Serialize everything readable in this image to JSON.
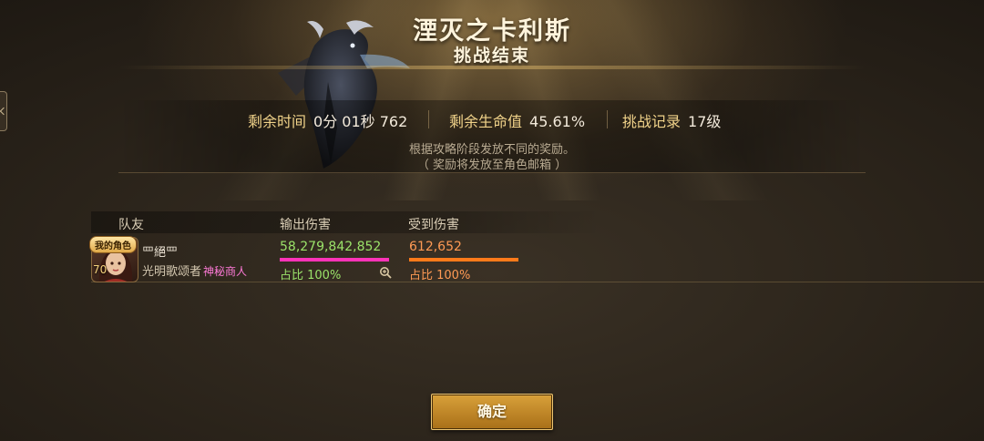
{
  "header": {
    "boss_name": "湮灭之卡利斯",
    "result_title": "挑战结束"
  },
  "stats": {
    "time_label": "剩余时间",
    "time_value": "0分 01秒 762",
    "hp_label": "剩余生命值",
    "hp_value": "45.61%",
    "record_label": "挑战记录",
    "record_value": "17级"
  },
  "notes": {
    "line1": "根据攻略阶段发放不同的奖励。",
    "line2": "（ 奖励将发放至角色邮箱 ）"
  },
  "table": {
    "col_teammate": "队友",
    "col_damage_dealt": "输出伤害",
    "col_damage_taken": "受到伤害"
  },
  "player": {
    "badge": "我的角色",
    "level": "70",
    "name": "罒絕罒",
    "class_name": "光明歌颂者",
    "guild": "神秘商人",
    "damage_dealt": "58,279,842,852",
    "dealt_share_label": "占比 100%",
    "dealt_share": 1.0,
    "damage_taken": "612,652",
    "taken_share_label": "占比 100%",
    "taken_share": 1.0
  },
  "colors": {
    "dealt": "#ff33b8",
    "dealt_text": "#9be36a",
    "taken": "#ff7a1a",
    "taken_text": "#ff9a54"
  },
  "buttons": {
    "confirm": "确定"
  }
}
